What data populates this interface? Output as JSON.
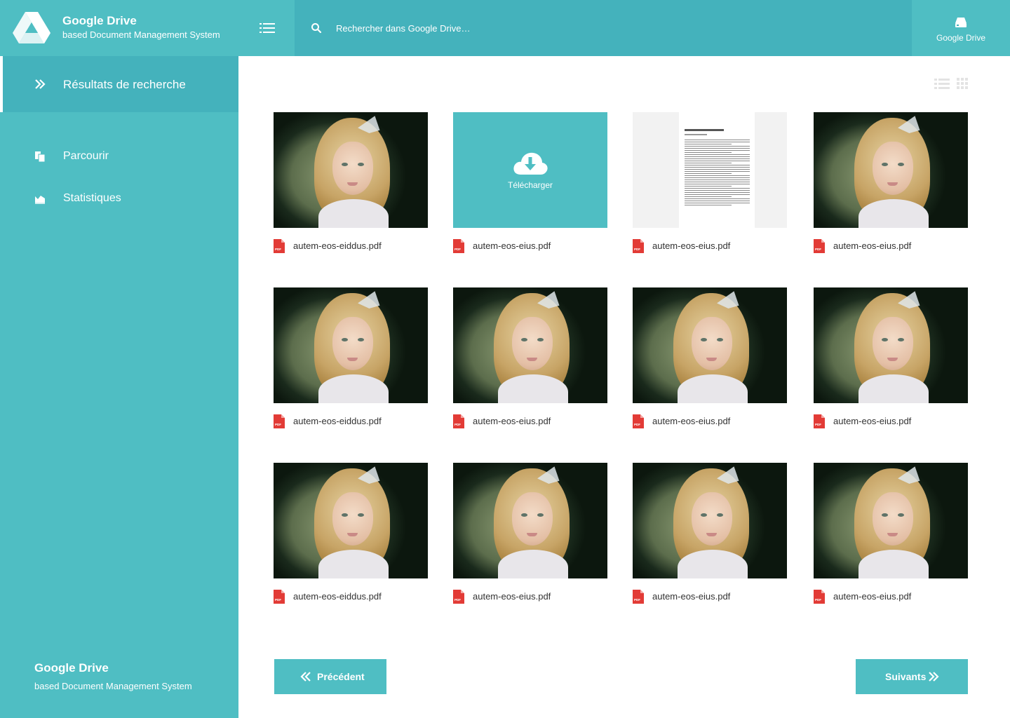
{
  "header": {
    "brand_title": "Google Drive",
    "brand_subtitle": "based Document Management System",
    "search_placeholder": "Rechercher dans Google Drive…",
    "drive_button_label": "Google Drive"
  },
  "sidebar": {
    "active_item": {
      "label": "Résultats de recherche",
      "icon": "double-chevron-right-icon"
    },
    "items": [
      {
        "label": "Parcourir",
        "icon": "copy-files-icon"
      },
      {
        "label": "Statistiques",
        "icon": "area-chart-icon"
      }
    ],
    "footer_title": "Google Drive",
    "footer_subtitle": "based Document Management System"
  },
  "view_toggles": [
    "list-view-icon",
    "grid-view-icon"
  ],
  "files": [
    {
      "name": "autem-eos-eiddus.pdf",
      "thumb": "photo"
    },
    {
      "name": "autem-eos-eius.pdf",
      "thumb": "upload",
      "overlay_label": "Télécharger"
    },
    {
      "name": "autem-eos-eius.pdf",
      "thumb": "document"
    },
    {
      "name": "autem-eos-eius.pdf",
      "thumb": "photo"
    },
    {
      "name": "autem-eos-eiddus.pdf",
      "thumb": "photo"
    },
    {
      "name": "autem-eos-eius.pdf",
      "thumb": "photo"
    },
    {
      "name": "autem-eos-eius.pdf",
      "thumb": "photo"
    },
    {
      "name": "autem-eos-eius.pdf",
      "thumb": "photo"
    },
    {
      "name": "autem-eos-eiddus.pdf",
      "thumb": "photo"
    },
    {
      "name": "autem-eos-eius.pdf",
      "thumb": "photo"
    },
    {
      "name": "autem-eos-eius.pdf",
      "thumb": "photo"
    },
    {
      "name": "autem-eos-eius.pdf",
      "thumb": "photo"
    }
  ],
  "pagination": {
    "prev_label": "Précédent",
    "next_label": "Suivants"
  },
  "colors": {
    "accent": "#4fbec3",
    "accent_dark": "#44b2bc",
    "pdf_red": "#e23b36"
  }
}
